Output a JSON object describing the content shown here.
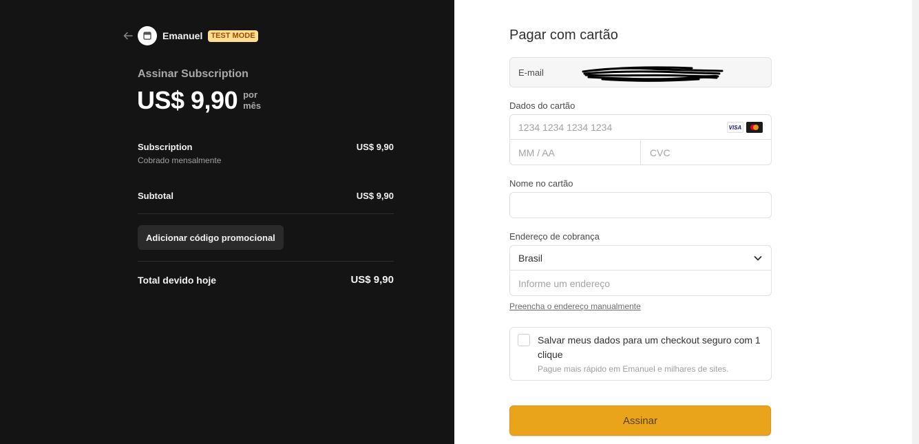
{
  "colors": {
    "left_bg": "#141414",
    "badge_bg": "#ffde92",
    "badge_text": "#a24a00",
    "submit_bg": "#e9a41c"
  },
  "merchant": {
    "back_icon": "arrow-left-icon",
    "logo_icon": "store-icon",
    "name": "Emanuel",
    "badge": "TEST MODE"
  },
  "plan": {
    "title": "Assinar Subscription",
    "price": "US$ 9,90",
    "period_line1": "por",
    "period_line2": "mês"
  },
  "line_items": [
    {
      "name": "Subscription",
      "sub": "Cobrado mensalmente",
      "amount": "US$ 9,90"
    }
  ],
  "subtotal": {
    "label": "Subtotal",
    "amount": "US$ 9,90"
  },
  "promo_button": "Adicionar código promocional",
  "total": {
    "label": "Total devido hoje",
    "amount": "US$ 9,90"
  },
  "form": {
    "title": "Pagar com cartão",
    "email_label": "E-mail",
    "card_label": "Dados do cartão",
    "card_number_placeholder": "1234 1234 1234 1234",
    "card_brands": [
      "VISA",
      "mastercard-icon"
    ],
    "visa_text": "VISA",
    "expiry_placeholder": "MM / AA",
    "cvc_placeholder": "CVC",
    "name_label": "Nome no cartão",
    "address_label": "Endereço de cobrança",
    "country": "Brasil",
    "address_placeholder": "Informe um endereço",
    "manual_link": "Preencha o endereço manualmente",
    "save_text": "Salvar meus dados para um checkout seguro com 1 clique",
    "save_sub": "Pague mais rápido em Emanuel e milhares de sites.",
    "submit": "Assinar"
  }
}
